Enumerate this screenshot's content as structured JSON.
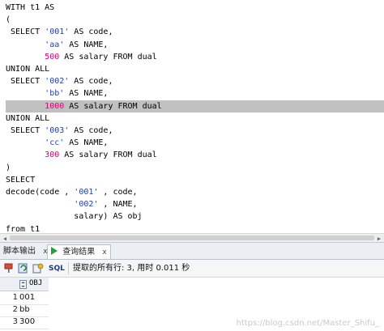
{
  "editor": {
    "lines": [
      {
        "type": "plain",
        "text": "WITH t1 AS"
      },
      {
        "type": "plain",
        "text": "("
      },
      {
        "type": "str",
        "pre": " SELECT ",
        "str": "'001'",
        "post": " AS code,"
      },
      {
        "type": "str",
        "pre": "        ",
        "str": "'aa'",
        "post": " AS NAME,"
      },
      {
        "type": "num",
        "pre": "        ",
        "num": "500",
        "post": " AS salary FROM dual"
      },
      {
        "type": "plain",
        "text": "UNION ALL"
      },
      {
        "type": "str",
        "pre": " SELECT ",
        "str": "'002'",
        "post": " AS code,"
      },
      {
        "type": "str",
        "pre": "        ",
        "str": "'bb'",
        "post": " AS NAME,"
      },
      {
        "type": "num",
        "pre": "        ",
        "num": "1000",
        "post": " AS salary FROM dual",
        "highlight": true
      },
      {
        "type": "plain",
        "text": "UNION ALL"
      },
      {
        "type": "str",
        "pre": " SELECT ",
        "str": "'003'",
        "post": " AS code,"
      },
      {
        "type": "str",
        "pre": "        ",
        "str": "'cc'",
        "post": " AS NAME,"
      },
      {
        "type": "num",
        "pre": "        ",
        "num": "300",
        "post": " AS salary FROM dual"
      },
      {
        "type": "plain",
        "text": ")"
      },
      {
        "type": "plain",
        "text": "SELECT"
      },
      {
        "type": "str",
        "pre": "decode(code , ",
        "str": "'001'",
        "post": " , code,"
      },
      {
        "type": "str",
        "pre": "              ",
        "str": "'002'",
        "post": " , NAME,"
      },
      {
        "type": "plain",
        "text": "              salary) AS obj"
      },
      {
        "type": "plain",
        "text": "from t1"
      }
    ]
  },
  "tabs": {
    "script_output": "脚本输出",
    "query_result": "查询结果",
    "close_glyph": "x"
  },
  "toolbar": {
    "sql_label": "SQL",
    "status": "提取的所有行: 3, 用时 0.011 秒"
  },
  "grid": {
    "column": "OBJ",
    "rows": [
      {
        "num": "1",
        "value": "001"
      },
      {
        "num": "2",
        "value": "bb"
      },
      {
        "num": "3",
        "value": "300"
      }
    ]
  },
  "watermark": "https://blog.csdn.net/Master_Shifu_",
  "colors": {
    "string": "#1f3fb0",
    "number": "#e0007a",
    "highlight": "#c0c0c0",
    "play_icon": "#23a33a"
  }
}
